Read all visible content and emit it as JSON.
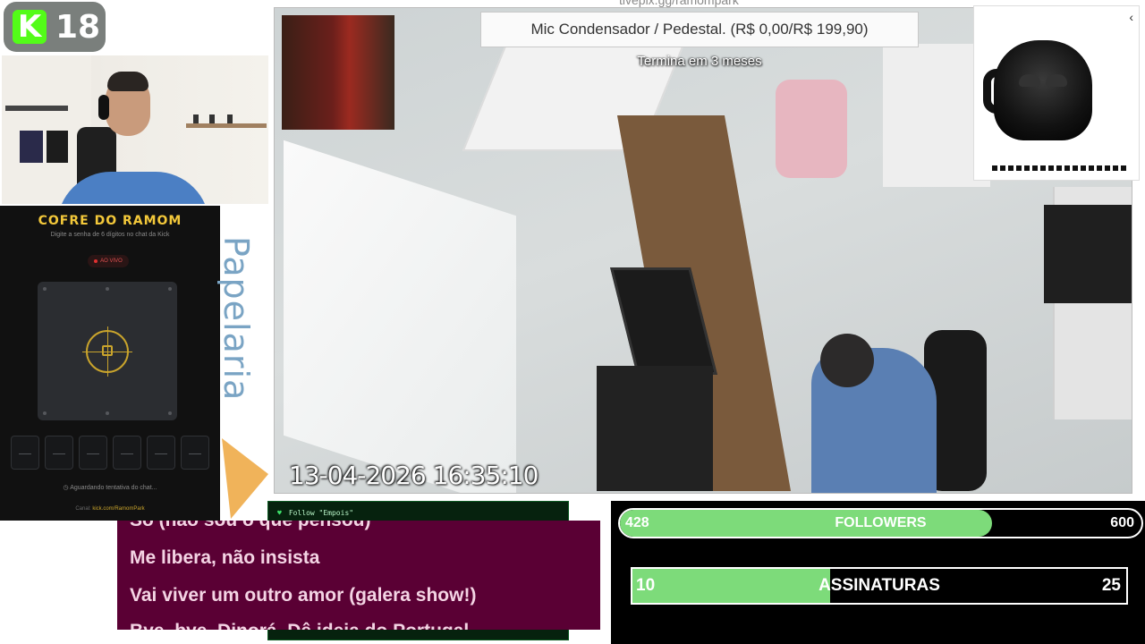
{
  "logo": {
    "letter": "K",
    "number": "18",
    "brand_color": "#53fc18"
  },
  "vault": {
    "title": "COFRE DO RAMOM",
    "subtitle": "Digite a senha de 6 dígitos no chat da Kick",
    "live_label": "AO VIVO",
    "digits": [
      "—",
      "—",
      "—",
      "—",
      "—",
      "—"
    ],
    "status": "Aguardando tentativa do chat...",
    "link_prefix": "Canal:",
    "link": "kick.com/RamomPark",
    "accent": "#f3c83a"
  },
  "side_label": "Papelaria",
  "camera": {
    "url": "tivepix.gg/ramompark",
    "timestamp": "13-04-2026 16:35:10"
  },
  "goal": {
    "text": "Mic Condensador / Pedestal. (R$ 0,00/R$ 199,90)",
    "timer": "Termina em 3 meses"
  },
  "product": {
    "close_icon": "‹"
  },
  "ticker": {
    "icon": "heart-icon",
    "text": "Follow \"Empois\""
  },
  "lyrics": {
    "lines": [
      "So (não sou o que pensou)",
      "Me libera, não insista",
      "Vai viver um outro amor (galera show!)",
      "Bye, bye, Dinorá, Dê ideia do Portugal"
    ]
  },
  "goals": {
    "followers": {
      "label": "FOLLOWERS",
      "current": "428",
      "target": "600",
      "progress": 0.713
    },
    "subs": {
      "label": "ASSINATURAS",
      "current": "10",
      "target": "25",
      "progress": 0.4
    },
    "bar_color": "#7ddb7a"
  }
}
